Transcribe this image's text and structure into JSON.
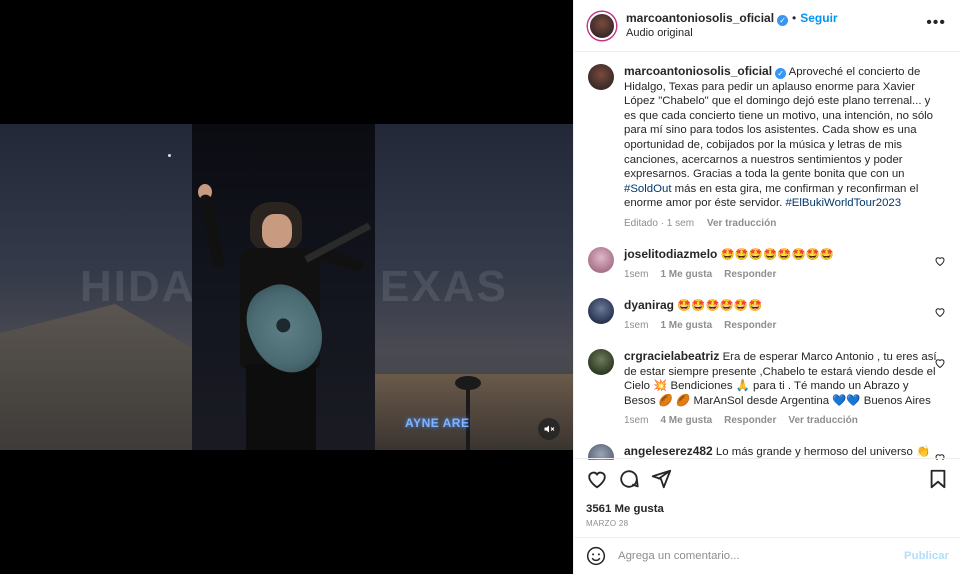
{
  "media": {
    "watermark_left": "HIDA",
    "watermark_right": "EXAS",
    "arena_sign": "AYNE ARE",
    "mute_icon": "volume-off-icon"
  },
  "header": {
    "username": "marcoantoniosolis_oficial",
    "follow_label": "Seguir",
    "audio_label": "Audio original",
    "more_icon": "more-horizontal-icon"
  },
  "caption": {
    "username": "marcoantoniosolis_oficial",
    "text": "Aproveché el concierto de Hidalgo, Texas para pedir un aplauso enorme para Xavier López \"Chabelo\" que el domingo dejó este plano terrenal... y es que cada concierto tiene un motivo, una intención, no sólo para mí sino para todos los asistentes. Cada show es una oportunidad de, cobijados por la música y letras de mis canciones, acercarnos a nuestros sentimientos y poder expresarnos. Gracias a toda la gente bonita que con un ",
    "hashtag1": "#SoldOut",
    "text2": " más en esta gira, me confirman y reconfirman el enorme amor por éste servidor. ",
    "hashtag2": "#ElBukiWorldTour2023",
    "edited": "Editado · 1 sem",
    "translate": "Ver traducción"
  },
  "comments": [
    {
      "username": "joselitodiazmelo",
      "text": "🤩🤩🤩🤩🤩🤩🤩🤩",
      "time": "1sem",
      "likes": "1 Me gusta",
      "reply": "Responder",
      "translate": ""
    },
    {
      "username": "dyanirag",
      "text": "🤩🤩🤩🤩🤩🤩",
      "time": "1sem",
      "likes": "1 Me gusta",
      "reply": "Responder",
      "translate": ""
    },
    {
      "username": "crgracielabeatriz",
      "text": "Era de esperar Marco Antonio , tu eres así de estar siempre presente ,Chabelo te estará viendo desde el Cielo 💥 Bendiciones 🙏 para ti . Té mando un Abrazo y Besos 🏉 🏉 MarAnSol desde Argentina 💙💙 Buenos Aires",
      "time": "1sem",
      "likes": "4 Me gusta",
      "reply": "Responder",
      "translate": "Ver traducción"
    },
    {
      "username": "angeleserez482",
      "text": "Lo más grande y hermoso del universo 👏👏",
      "time": "",
      "likes": "",
      "reply": "",
      "translate": ""
    }
  ],
  "actions": {
    "like_icon": "heart-icon",
    "comment_icon": "comment-icon",
    "share_icon": "share-icon",
    "save_icon": "bookmark-icon",
    "likes_count": "3561 Me gusta",
    "date": "MARZO 28"
  },
  "add_comment": {
    "emoji_icon": "emoji-icon",
    "placeholder": "Agrega un comentario...",
    "publish_label": "Publicar"
  },
  "colors": {
    "accent": "#0095f6",
    "verified": "#3897f0",
    "hashtag": "#00376b",
    "muted": "#8e8e8e"
  }
}
